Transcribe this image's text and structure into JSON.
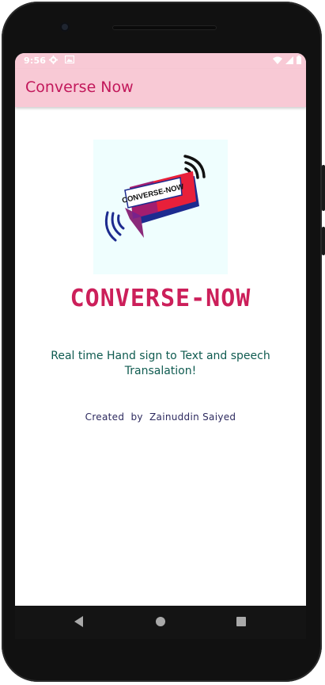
{
  "status_bar": {
    "time": "9:56",
    "left_icons": [
      "gear-icon",
      "image-icon"
    ],
    "right_icons": [
      "wifi-icon",
      "signal-icon",
      "battery-icon"
    ]
  },
  "app_bar": {
    "title": "Converse Now"
  },
  "logo": {
    "text": "CONVERSE-NOW",
    "colors": {
      "background": "#effefe",
      "red": "#e8203a",
      "blue": "#1d2b8f",
      "purple": "#8b2a7a"
    }
  },
  "brand": {
    "text": "CONVERSE-NOW"
  },
  "tagline": {
    "text": "Real time Hand sign to Text and speech Transalation!"
  },
  "credit": {
    "text": "Created  by  Zainuddin Saiyed"
  },
  "nav": {
    "icons": [
      "back-icon",
      "home-icon",
      "recents-icon"
    ]
  },
  "theme": {
    "app_bar_color": "#f8c9d5",
    "title_color": "#c2185b",
    "brand_color": "#cc1f5a",
    "tagline_color": "#0f5b50",
    "credit_color": "#2d2a5f"
  }
}
